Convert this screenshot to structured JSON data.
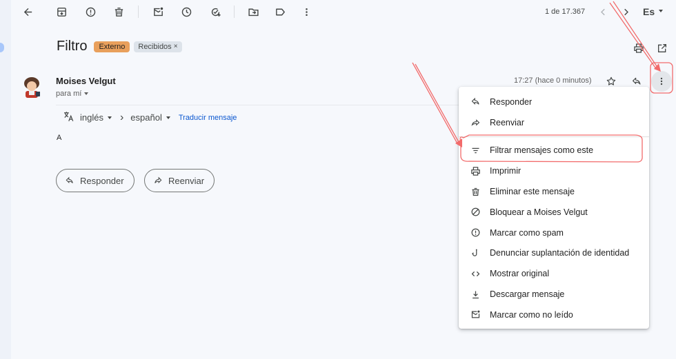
{
  "toolbar": {
    "pagination": "1 de 17.367",
    "language": "Es"
  },
  "message": {
    "subject": "Filtro",
    "labels": [
      {
        "name": "Externo",
        "color": "#e9a05c"
      },
      {
        "name": "Recibidos"
      }
    ],
    "label_remove": "×",
    "sender": "Moises Velgut",
    "recipient": "para mí",
    "time": "17:27 (hace 0 minutos)",
    "body": "A"
  },
  "translate": {
    "from": "inglés",
    "to": "español",
    "link": "Traducir mensaje"
  },
  "actions": {
    "reply": "Responder",
    "forward": "Reenviar"
  },
  "menu": {
    "items": [
      {
        "label": "Responder",
        "icon": "reply-icon"
      },
      {
        "label": "Reenviar",
        "icon": "forward-icon"
      },
      {
        "label": "Filtrar mensajes como este",
        "icon": "filter-icon"
      },
      {
        "label": "Imprimir",
        "icon": "print-icon"
      },
      {
        "label": "Eliminar este mensaje",
        "icon": "trash-icon"
      },
      {
        "label": "Bloquear a Moises Velgut",
        "icon": "block-icon"
      },
      {
        "label": "Marcar como spam",
        "icon": "spam-icon"
      },
      {
        "label": "Denunciar suplantación de identidad",
        "icon": "phishing-icon"
      },
      {
        "label": "Mostrar original",
        "icon": "code-icon"
      },
      {
        "label": "Descargar mensaje",
        "icon": "download-icon"
      },
      {
        "label": "Marcar como no leído",
        "icon": "mark-unread-icon"
      }
    ]
  },
  "colors": {
    "background": "#f6f8fc",
    "annotation": "#f26b6b",
    "link": "#0b57d0"
  }
}
